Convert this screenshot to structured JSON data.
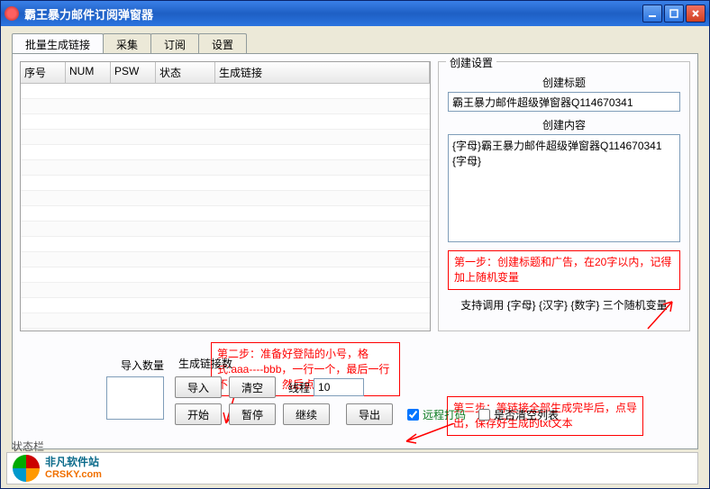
{
  "window": {
    "title": "霸王暴力邮件订阅弹窗器"
  },
  "tabs": [
    {
      "label": "批量生成链接",
      "active": true
    },
    {
      "label": "采集",
      "active": false
    },
    {
      "label": "订阅",
      "active": false
    },
    {
      "label": "设置",
      "active": false
    }
  ],
  "table": {
    "headers": [
      "序号",
      "NUM",
      "PSW",
      "状态",
      "生成链接"
    ]
  },
  "right": {
    "group_title": "创建设置",
    "title_label": "创建标题",
    "title_value": "霸王暴力邮件超级弹窗器Q114670341",
    "content_label": "创建内容",
    "content_value": "{字母}霸王暴力邮件超级弹窗器Q114670341 {字母}",
    "step1_note": "第一步：创建标题和广告，在20字以内，记得加上随机变量",
    "support_text": "支持调用 {字母} {汉字} {数字} 三个随机变量"
  },
  "bottom": {
    "import_count_label": "导入数量",
    "gen_count_label": "生成链接数",
    "btn_import": "导入",
    "btn_clear": "清空",
    "thread_label": "线程",
    "thread_value": "10",
    "btn_start": "开始",
    "btn_pause": "暂停",
    "btn_continue": "继续",
    "btn_export": "导出",
    "chk_remote": "远程打码",
    "chk_clearlist": "是否清空列表",
    "step2_note": "第二步：准备好登陆的小号，格式:aaa----bbb，一行一个，最后一行不能留空格，然后点导入",
    "step3_note": "第三步：等链接全部生成完毕后，点导出，保存好生成的txt文本"
  },
  "status": {
    "label": "状态栏",
    "brand_cn": "非凡软件站",
    "brand_en": "CRSKY.com"
  }
}
